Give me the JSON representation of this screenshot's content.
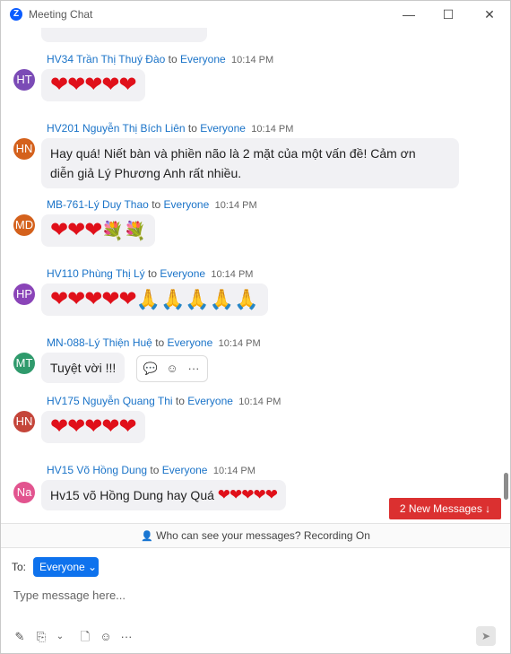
{
  "window": {
    "title": "Meeting Chat",
    "app_icon": "Z",
    "minimize_icon": "—",
    "maximize_icon": "☐",
    "close_icon": "✕"
  },
  "colors": {
    "accent": "#0e72ed",
    "link": "#1a73c8",
    "alert": "#db3030"
  },
  "messages": [
    {
      "initials": "HT",
      "avatar_color": "#7b4bb6",
      "sender": "HV34 Trần Thị Thuý Đào",
      "to_word": "to",
      "recipient": "Everyone",
      "time": "10:14 PM",
      "content": "❤❤❤❤❤"
    },
    {
      "initials": "HN",
      "avatar_color": "#d4611c",
      "sender": "HV201 Nguyễn Thị Bích Liên",
      "to_word": "to",
      "recipient": "Everyone",
      "time": "10:14 PM",
      "line1": "Hay quá! Niết bàn và phiền não là 2 mặt của một vấn đề! Cảm ơn",
      "line2": "diễn giả Lý Phương Anh rất nhiều."
    },
    {
      "initials": "MD",
      "avatar_color": "#d4611c",
      "sender": "MB-761-Lý Duy Thao",
      "to_word": "to",
      "recipient": "Everyone",
      "time": "10:14 PM",
      "hearts": "❤❤❤",
      "extra": "💐💐"
    },
    {
      "initials": "HP",
      "avatar_color": "#8a44b8",
      "sender": "HV110  Phùng Thị Lý",
      "to_word": "to",
      "recipient": "Everyone",
      "time": "10:14 PM",
      "hearts": "❤❤❤❤❤",
      "extra": "🙏🙏🙏🙏🙏"
    },
    {
      "initials": "MT",
      "avatar_color": "#2f9a6c",
      "sender": "MN-088-Lý Thiện Huệ",
      "to_word": "to",
      "recipient": "Everyone",
      "time": "10:14 PM",
      "content": "Tuyệt vời !!!"
    },
    {
      "initials": "HN",
      "avatar_color": "#c4453a",
      "sender": "HV175 Nguyễn Quang Thi",
      "to_word": "to",
      "recipient": "Everyone",
      "time": "10:14 PM",
      "content": "❤❤❤❤❤"
    },
    {
      "initials": "Na",
      "avatar_color": "#e2548f",
      "sender": "HV15 Võ Hồng Dung",
      "to_word": "to",
      "recipient": "Everyone",
      "time": "10:14 PM",
      "text": "Hv15 võ Hồng Dung hay Quá ",
      "hearts": "❤❤❤❤❤"
    }
  ],
  "message_actions": {
    "reply_icon": "💬",
    "reaction_icon": "☺",
    "more_icon": "···"
  },
  "new_messages_label": "2 New Messages ↓",
  "privacy": {
    "icon": "👤",
    "text": "Who can see your messages? Recording On"
  },
  "composer": {
    "to_label": "To:",
    "recipient": "Everyone ⌄",
    "placeholder": "Type message here...",
    "tools": [
      "✎",
      "⎘",
      "⌄",
      "🗋",
      "☺",
      "···"
    ],
    "send_icon": "➤"
  }
}
